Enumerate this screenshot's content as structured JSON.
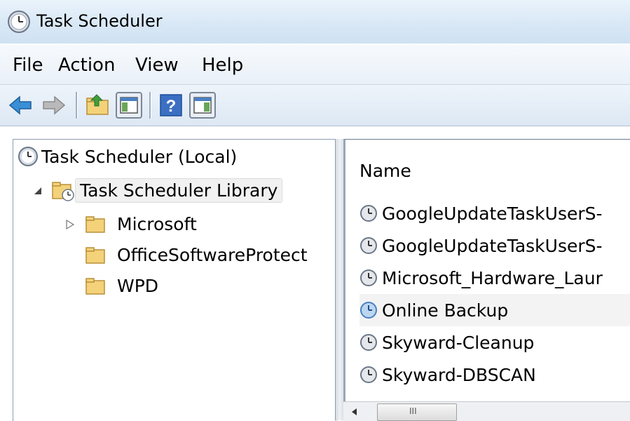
{
  "window": {
    "title": "Task Scheduler"
  },
  "menu": [
    "File",
    "Action",
    "View",
    "Help"
  ],
  "toolbar": {
    "buttons": [
      "back-arrow-icon",
      "forward-arrow-icon",
      "up-folder-icon",
      "show-hide-console-tree-icon",
      "help-icon",
      "show-hide-action-pane-icon"
    ]
  },
  "tree": {
    "root": "Task Scheduler (Local)",
    "library": "Task Scheduler Library",
    "folders": [
      "Microsoft",
      "OfficeSoftwareProtect",
      "WPD"
    ]
  },
  "list": {
    "column": "Name",
    "rows": [
      "GoogleUpdateTaskUserS-",
      "GoogleUpdateTaskUserS-",
      "Microsoft_Hardware_Laur",
      "Online Backup",
      "Skyward-Cleanup",
      "Skyward-DBSCAN"
    ],
    "highlighted_index": 3
  },
  "scrollbar": {
    "grip": "III"
  },
  "colors": {
    "accent": "#4a7fc1",
    "folder": "#f3d27a",
    "highlight_row": "#f3f3f3"
  }
}
